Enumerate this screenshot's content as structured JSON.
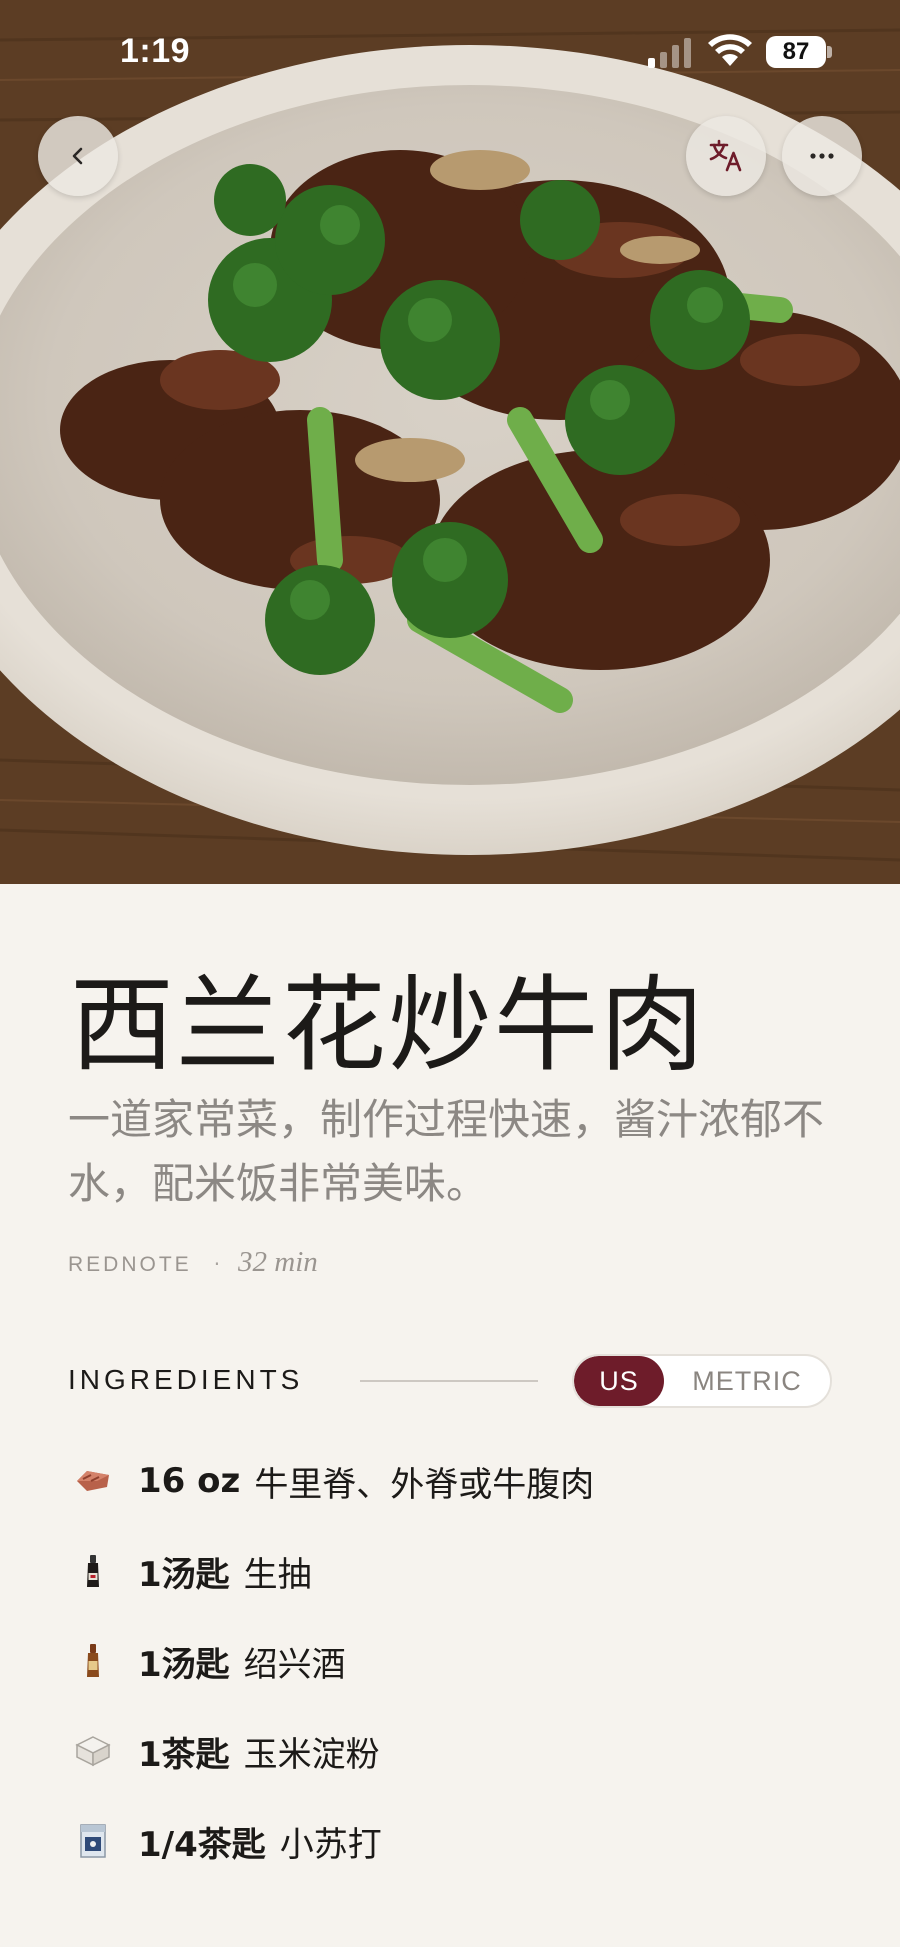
{
  "status_bar": {
    "time": "1:19",
    "battery": "87"
  },
  "hero": {
    "image": "beef-and-broccoli-photo"
  },
  "header_buttons": {
    "back_icon": "chevron-left-icon",
    "translate_icon": "translate-icon",
    "more_icon": "ellipsis-icon"
  },
  "recipe": {
    "title": "西兰花炒牛肉",
    "description": "一道家常菜，制作过程快速，酱汁浓郁不水，配米饭非常美味。",
    "source": "REDNOTE",
    "separator": "·",
    "duration": "32 min"
  },
  "ingredients": {
    "heading": "INGREDIENTS",
    "units": {
      "us": "US",
      "metric": "METRIC",
      "selected": "US"
    },
    "items": [
      {
        "icon": "beef-icon",
        "qty": "16 oz",
        "name": "牛里脊、外脊或牛腹肉"
      },
      {
        "icon": "soy-sauce-bottle-icon",
        "qty": "1汤匙",
        "name": "生抽"
      },
      {
        "icon": "wine-bottle-icon",
        "qty": "1汤匙",
        "name": "绍兴酒"
      },
      {
        "icon": "cornstarch-box-icon",
        "qty": "1茶匙",
        "name": "玉米淀粉"
      },
      {
        "icon": "baking-soda-box-icon",
        "qty": "1/4茶匙",
        "name": "小苏打"
      }
    ]
  },
  "colors": {
    "accent": "#6e1c2a",
    "background": "#f6f3ee",
    "title_text": "#1c1a18",
    "muted_text": "#8c8884"
  }
}
